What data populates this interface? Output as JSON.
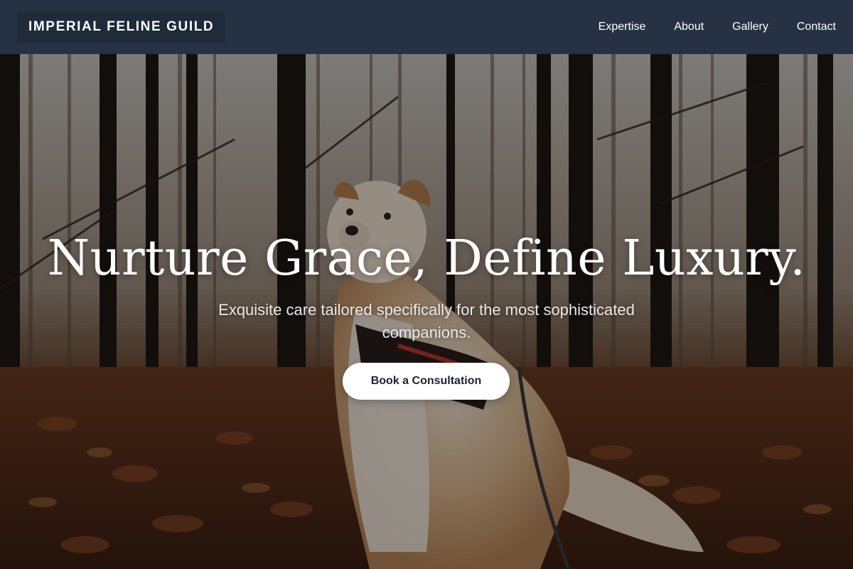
{
  "brand": {
    "name": "IMPERIAL FELINE GUILD"
  },
  "nav": {
    "items": [
      {
        "label": "Expertise"
      },
      {
        "label": "About"
      },
      {
        "label": "Gallery"
      },
      {
        "label": "Contact"
      }
    ]
  },
  "hero": {
    "title": "Nurture Grace, Define Luxury.",
    "subtitle": "Exquisite care tailored specifically for the most sophisticated companions.",
    "cta_label": "Book a Consultation",
    "background_image": "dog-in-autumn-forest-photo",
    "colors": {
      "header": "#263244",
      "logo_bg": "#1f2a3b",
      "cta_bg": "#ffffff",
      "cta_text": "#1d2331"
    }
  }
}
